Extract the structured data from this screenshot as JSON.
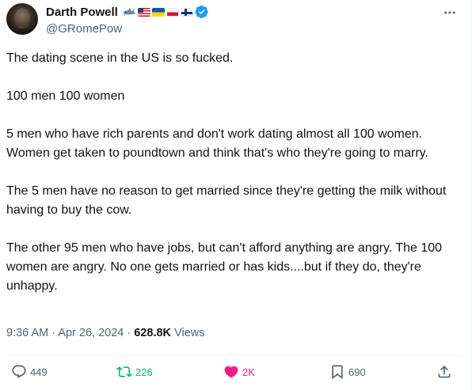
{
  "author": {
    "display_name": "Darth Powell",
    "handle": "@GRomePow",
    "badges": [
      "shark-emoji",
      "flag-us",
      "flag-ua",
      "flag-pl",
      "flag-fi",
      "verified-badge"
    ]
  },
  "tweet": {
    "paragraphs": [
      "The dating scene in the US is so fucked.",
      "100 men 100 women",
      "5 men who have rich parents and don't work dating almost all 100 women. Women get taken to poundtown and think that's who they're going to marry.",
      "The 5 men have no reason to get married since they're getting the milk without having to buy the cow.",
      "The other 95 men who have jobs, but can't afford anything are angry.  The 100 women are angry.  No one gets married or has kids....but if they do, they're unhappy."
    ]
  },
  "meta": {
    "time": "9:36 AM",
    "separator": "·",
    "date": "Apr 26, 2024",
    "views_count": "628.8K",
    "views_label": "Views"
  },
  "actions": {
    "replies": "449",
    "reposts": "226",
    "likes": "2K",
    "bookmarks": "690"
  },
  "colors": {
    "text_primary": "#0f1419",
    "text_secondary": "#536471",
    "repost_active": "#00ba7c",
    "like_active": "#f91880",
    "verified": "#1d9bf0"
  }
}
